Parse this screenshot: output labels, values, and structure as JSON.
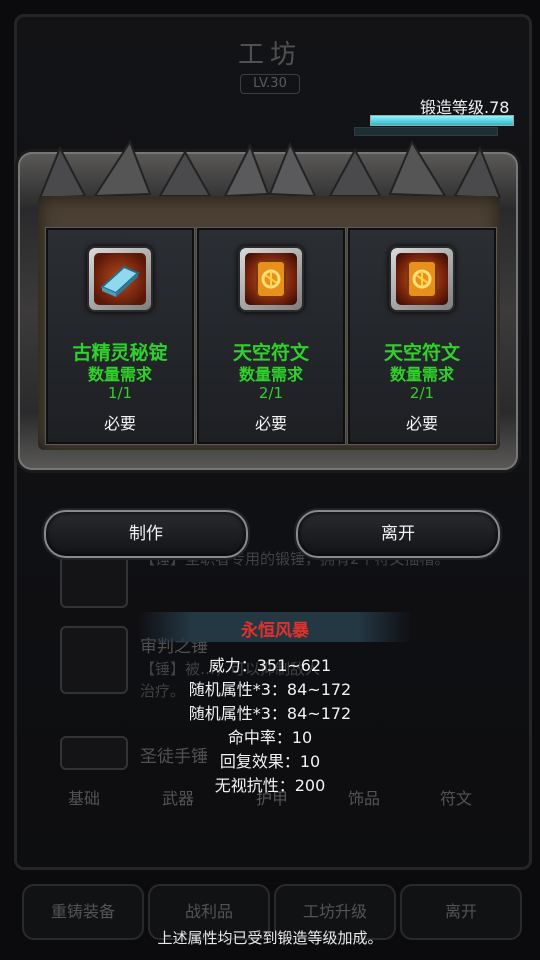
{
  "background": {
    "title": "工坊",
    "level": "LV.30",
    "rows": [
      {
        "name": "",
        "desc": "【锤】圣职者专用的锻锤，拥有2个符文插槽。"
      },
      {
        "name": "审判之锤",
        "desc": "【锤】被…，可以抑制敌人"
      },
      {
        "name": "",
        "desc": "治疗。"
      },
      {
        "name": "圣徒手锤",
        "desc": ""
      }
    ],
    "tabs": [
      "基础",
      "武器",
      "护甲",
      "饰品",
      "符文"
    ],
    "bottom_buttons": [
      "重铸装备",
      "战利品",
      "工坊升级",
      "离开"
    ]
  },
  "forge": {
    "label": "锻造等级.78",
    "progress": 1.0,
    "color": "#4fd8e8"
  },
  "materials": [
    {
      "name": "古精灵秘锭",
      "req_label": "数量需求",
      "count": "1/1",
      "must": "必要",
      "icon": "silver-ingot-icon"
    },
    {
      "name": "天空符文",
      "req_label": "数量需求",
      "count": "2/1",
      "must": "必要",
      "icon": "sky-rune-icon"
    },
    {
      "name": "天空符文",
      "req_label": "数量需求",
      "count": "2/1",
      "must": "必要",
      "icon": "sky-rune-icon"
    }
  ],
  "actions": {
    "craft": "制作",
    "leave": "离开"
  },
  "tooltip": {
    "title": "永恒风暴",
    "title_color": "#e2312a",
    "lines": [
      "威力：351~621",
      "随机属性*3：84~172",
      "随机属性*3：84~172",
      "命中率：10",
      "回复效果：10",
      "无视抗性：200"
    ]
  },
  "footnote": "上述属性均已受到锻造等级加成。",
  "colors": {
    "requirement_text": "#2fd12a",
    "panel_inner": "#4b4033"
  }
}
